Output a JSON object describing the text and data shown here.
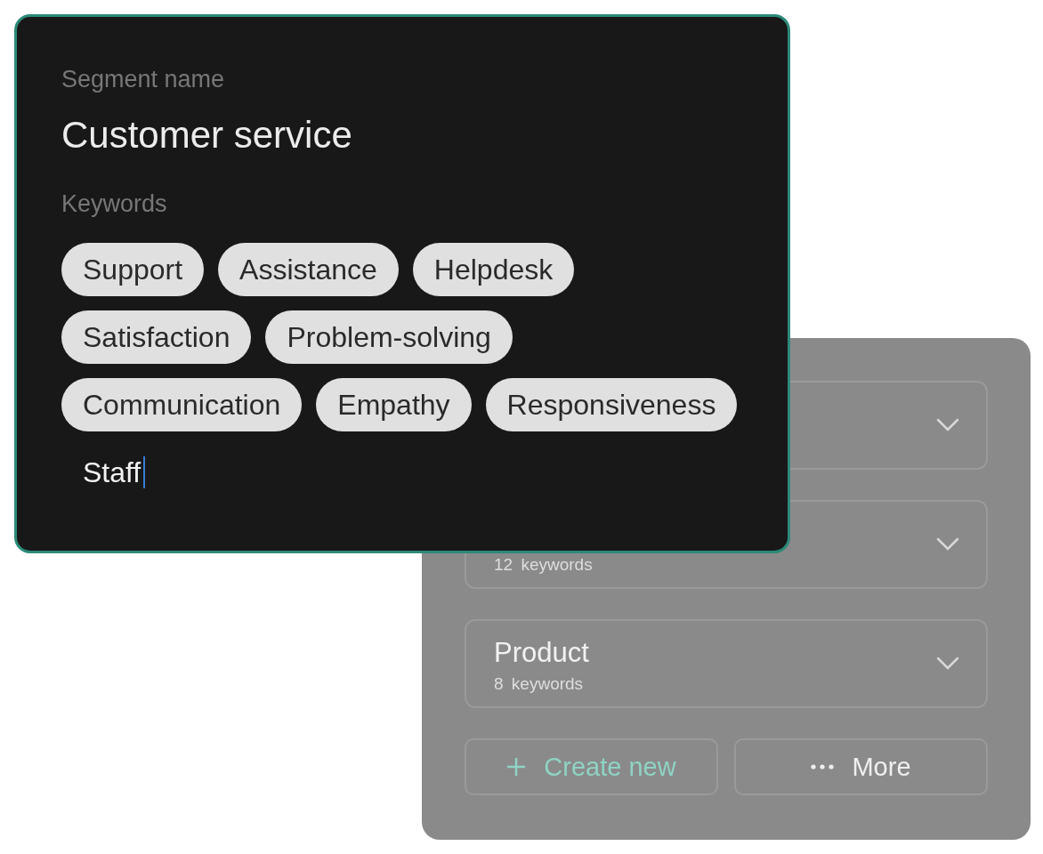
{
  "segment_editor": {
    "name_label": "Segment name",
    "name_value": "Customer service",
    "keywords_label": "Keywords",
    "keywords": [
      "Support",
      "Assistance",
      "Helpdesk",
      "Satisfaction",
      "Problem-solving",
      "Communication",
      "Empathy",
      "Responsiveness"
    ],
    "input": {
      "value": "Staff",
      "focused": true
    }
  },
  "segment_list": {
    "segments": [
      {
        "expanded": false
      },
      {
        "keyword_count": "12",
        "keyword_unit": "keywords",
        "expanded": false
      },
      {
        "name": "Product",
        "keyword_count": "8",
        "keyword_unit": "keywords",
        "expanded": false
      }
    ],
    "actions": [
      {
        "kind": "create",
        "label": "Create new"
      },
      {
        "kind": "more",
        "label": "More"
      }
    ]
  }
}
